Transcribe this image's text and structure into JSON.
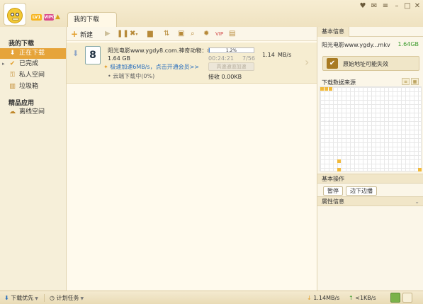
{
  "header": {
    "level_badge": "LV1",
    "vip_badge": "VIP0",
    "tab_label": "我的下载"
  },
  "sidebar": {
    "my_downloads_title": "我的下载",
    "items": [
      {
        "label": "正在下载",
        "icon": "download-icon"
      },
      {
        "label": "已完成",
        "icon": "check-icon"
      },
      {
        "label": "私人空间",
        "icon": "lock-icon"
      },
      {
        "label": "垃圾箱",
        "icon": "trash-icon"
      }
    ],
    "apps_title": "精品应用",
    "apps": [
      {
        "label": "离线空间",
        "icon": "cloud-icon"
      }
    ]
  },
  "toolbar": {
    "new_label": "新建"
  },
  "task": {
    "file_name": "阳光电影www.ygdy8.com.神奇动物：格...",
    "file_icon_text": "8",
    "size": "1.64 GB",
    "accelerate_text": "极速加速6MB/s，点击开通会员>>",
    "cloud_text": "云端下载中(0%)",
    "progress_text": "1.2%",
    "progress_value": 1.2,
    "elapsed": "00:24:21",
    "count": "7/56",
    "speed": "1.14",
    "speed_unit": "MB/s",
    "accel_button": "高速通道加速",
    "received": "接收 0.00KB"
  },
  "right_panel": {
    "basic_info_tab": "基本信息",
    "file_name": "阳光电影www.ygdy...mkv",
    "file_size": "1.64GB",
    "warning_text": "原始地址可能失效",
    "sources_title": "下载数据来源",
    "ops_title": "基本操作",
    "pause_label": "暂停",
    "play_label": "边下边播",
    "attr_title": "属性信息"
  },
  "statusbar": {
    "priority_label": "下载优先",
    "schedule_label": "计划任务",
    "down_speed": "1.14MB/s",
    "up_speed": "<1KB/s"
  }
}
